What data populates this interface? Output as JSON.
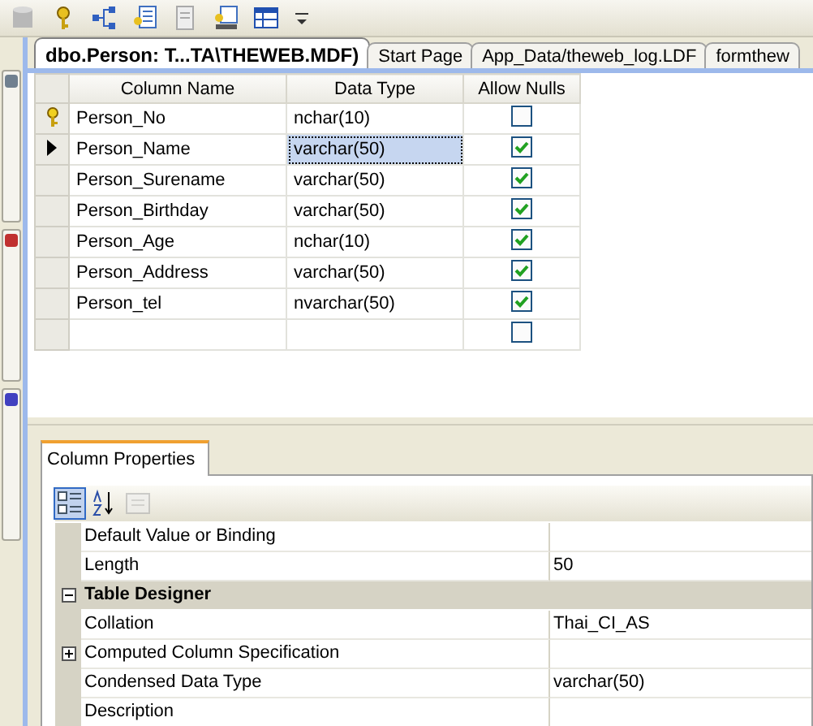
{
  "tabs": [
    {
      "label": "dbo.Person: T...TA\\THEWEB.MDF)",
      "selected": true
    },
    {
      "label": "Start Page",
      "selected": false
    },
    {
      "label": "App_Data/theweb_log.LDF",
      "selected": false
    },
    {
      "label": "formthew",
      "selected": false
    }
  ],
  "table": {
    "columns": [
      "Column Name",
      "Data Type",
      "Allow Nulls"
    ],
    "rows": [
      {
        "name": "Person_No",
        "type": "nchar(10)",
        "allow_nulls": false,
        "primary_key": true,
        "selected": false
      },
      {
        "name": "Person_Name",
        "type": "varchar(50)",
        "allow_nulls": true,
        "primary_key": false,
        "selected": true
      },
      {
        "name": "Person_Surename",
        "type": "varchar(50)",
        "allow_nulls": true,
        "primary_key": false,
        "selected": false
      },
      {
        "name": "Person_Birthday",
        "type": "varchar(50)",
        "allow_nulls": true,
        "primary_key": false,
        "selected": false
      },
      {
        "name": "Person_Age",
        "type": "nchar(10)",
        "allow_nulls": true,
        "primary_key": false,
        "selected": false
      },
      {
        "name": "Person_Address",
        "type": "varchar(50)",
        "allow_nulls": true,
        "primary_key": false,
        "selected": false
      },
      {
        "name": "Person_tel",
        "type": "nvarchar(50)",
        "allow_nulls": true,
        "primary_key": false,
        "selected": false
      },
      {
        "allow_nulls": false,
        "primary_key": false,
        "selected": false
      }
    ]
  },
  "properties": {
    "tab": "Column Properties",
    "toolbar": [
      {
        "kind": "categorized",
        "selected": true
      },
      {
        "kind": "alphabetical",
        "selected": false
      },
      {
        "kind": "pages",
        "disabled": true
      }
    ],
    "items": [
      {
        "kind": "property",
        "label": "Default Value or Binding"
      },
      {
        "kind": "property",
        "label": "Length",
        "value": "50"
      },
      {
        "kind": "category",
        "label": "Table Designer",
        "expanded": true
      },
      {
        "kind": "property",
        "label": "Collation",
        "value": "Thai_CI_AS"
      },
      {
        "kind": "property",
        "label": "Computed Column Specification",
        "expanded": false
      },
      {
        "kind": "property",
        "label": "Condensed Data Type",
        "value": "varchar(50)"
      },
      {
        "kind": "property",
        "label": "Description"
      }
    ]
  }
}
